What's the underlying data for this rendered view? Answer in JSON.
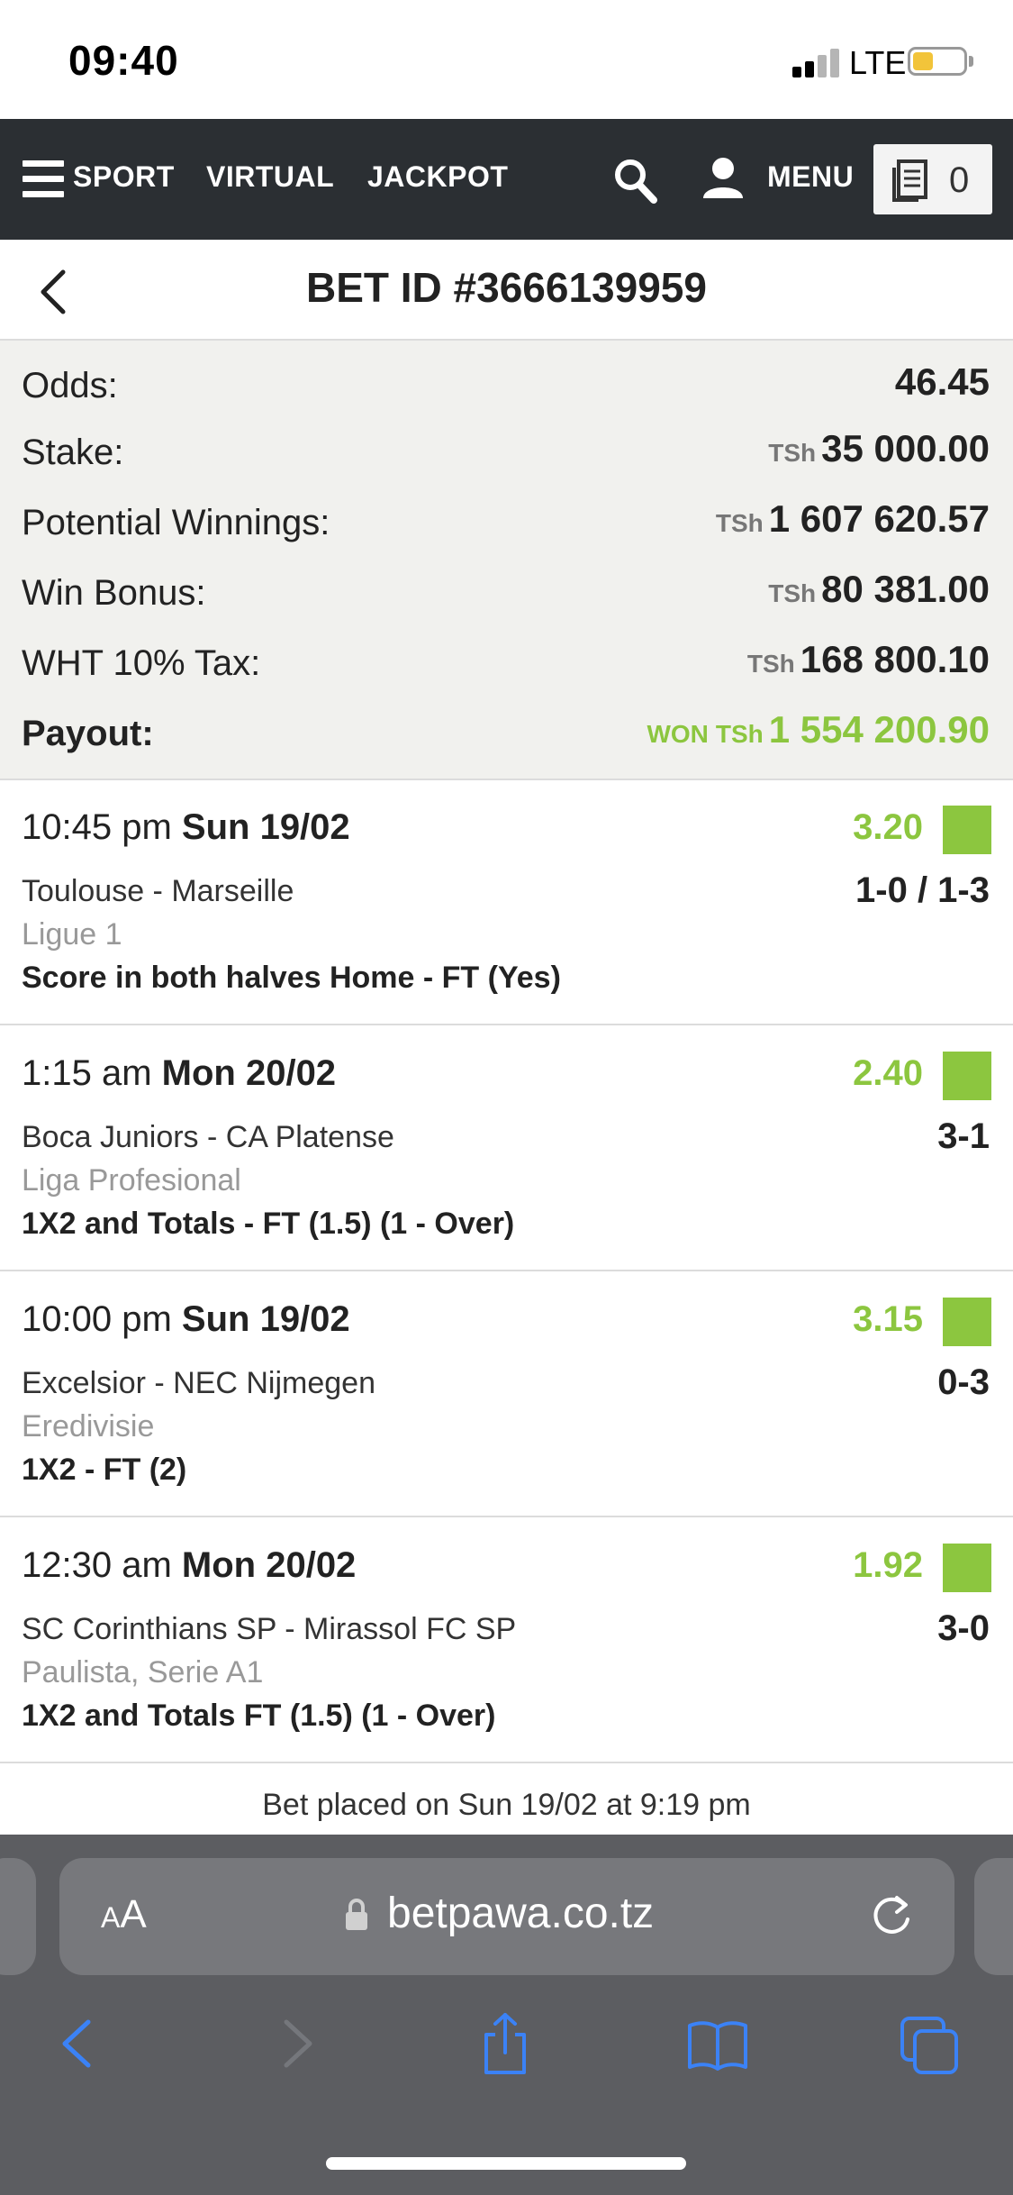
{
  "status_bar": {
    "time": "09:40",
    "network": "LTE",
    "signal_bars_active": 2,
    "signal_bars_total": 4,
    "battery_level": 0.3
  },
  "nav": {
    "menu_icon": "hamburger-icon",
    "sport": "SPORT",
    "virtual": "VIRTUAL",
    "jackpot": "JACKPOT",
    "search_icon": "search-icon",
    "user_icon": "user-icon",
    "menu": "MENU",
    "betslip_icon": "betslip-icon",
    "betslip_count": "0"
  },
  "header": {
    "back_icon": "chevron-left-icon",
    "title": "BET ID #3666139959"
  },
  "summary": {
    "odds_label": "Odds:",
    "odds_value": "46.45",
    "stake_label": "Stake:",
    "stake_currency": "TSh",
    "stake_value": "35 000.00",
    "potential_label": "Potential Winnings:",
    "potential_currency": "TSh",
    "potential_value": "1 607 620.57",
    "bonus_label": "Win Bonus:",
    "bonus_currency": "TSh",
    "bonus_value": "80 381.00",
    "tax_label": "WHT 10% Tax:",
    "tax_currency": "TSh",
    "tax_value": "168 800.10",
    "payout_label": "Payout:",
    "payout_status": "WON",
    "payout_currency": "TSh",
    "payout_value": "1 554 200.90"
  },
  "bets": [
    {
      "time": "10:45 pm",
      "date": "Sun 19/02",
      "odds": "3.20",
      "teams": "Toulouse - Marseille",
      "score": "1-0 / 1-3",
      "league": "Ligue 1",
      "market": "Score in both halves Home - FT (Yes)"
    },
    {
      "time": "1:15 am",
      "date": "Mon 20/02",
      "odds": "2.40",
      "teams": "Boca Juniors - CA Platense",
      "score": "3-1",
      "league": "Liga Profesional",
      "market": "1X2 and Totals - FT (1.5) (1 - Over)"
    },
    {
      "time": "10:00 pm",
      "date": "Sun 19/02",
      "odds": "3.15",
      "teams": "Excelsior - NEC Nijmegen",
      "score": "0-3",
      "league": "Eredivisie",
      "market": "1X2 - FT (2)"
    },
    {
      "time": "12:30 am",
      "date": "Mon 20/02",
      "odds": "1.92",
      "teams": "SC Corinthians SP - Mirassol FC SP",
      "score": "3-0",
      "league": "Paulista, Serie A1",
      "market": "1X2 and Totals FT (1.5) (1 - Over)"
    }
  ],
  "footer": {
    "placed": "Bet placed on Sun 19/02 at 9:19 pm"
  },
  "browser": {
    "text_size_big": "A",
    "text_size_small": "A",
    "url": "betpawa.co.tz",
    "lock_icon": "lock-icon",
    "reload_icon": "reload-icon",
    "back_icon": "back-icon",
    "forward_icon": "forward-icon",
    "share_icon": "share-icon",
    "bookmarks_icon": "bookmarks-icon",
    "tabs_icon": "tabs-icon"
  },
  "colors": {
    "won_green": "#8cc63f",
    "nav_bg": "#2b2f33",
    "summary_bg": "#f1f1ee",
    "browser_bg": "#5c5d61",
    "ios_blue": "#3b82f6"
  }
}
